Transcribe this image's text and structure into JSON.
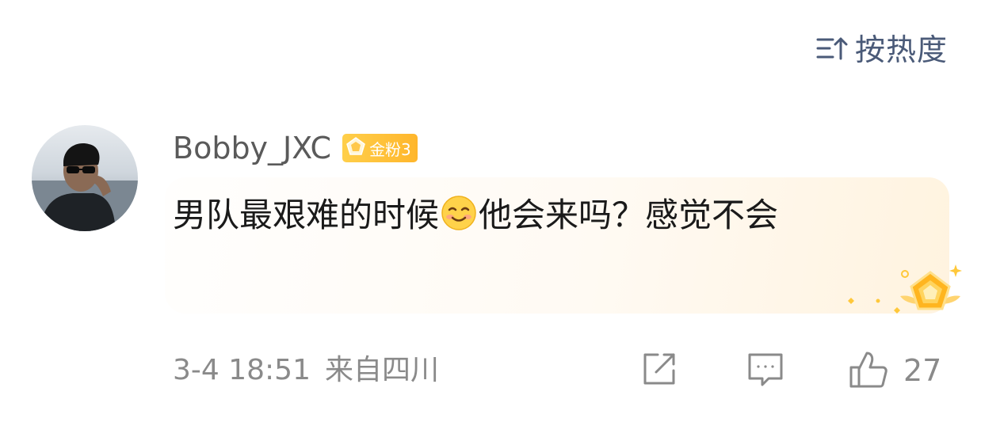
{
  "sort": {
    "label": "按热度",
    "icon": "sort-order-icon"
  },
  "comment": {
    "username": "Bobby_JXC",
    "badge_label": "金粉3",
    "text_part1": "男队最艰难的时候",
    "emoji": "blush-smile-emoji",
    "text_part2": "他会来吗？感觉不会",
    "timestamp": "3-4 18:51",
    "location": "来自四川",
    "like_count": "27"
  },
  "actions": {
    "share_icon": "share-icon",
    "reply_icon": "comment-icon",
    "like_icon": "thumbs-up-icon"
  },
  "colors": {
    "badge": "#ffbd33",
    "username": "#5a5a5a",
    "meta": "#8a8a8a",
    "sort": "#4a5a78"
  }
}
